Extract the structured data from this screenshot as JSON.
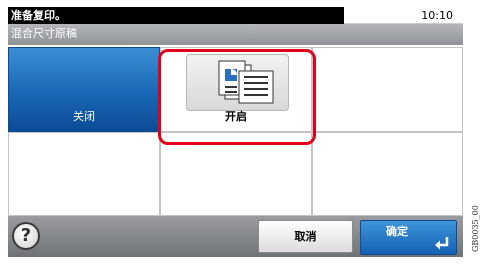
{
  "status": {
    "message": "准备复印。",
    "time": "10:10"
  },
  "title": "混合尺寸原稿",
  "options": [
    {
      "label": "关闭",
      "selected": true
    },
    {
      "label": "开启",
      "selected": false
    }
  ],
  "icons": {
    "help": "help-icon",
    "enter": "enter-icon",
    "option_on": "mixed-size-originals-icon"
  },
  "help_glyph": "?",
  "buttons": {
    "cancel": "取消",
    "ok": "确定"
  },
  "colors": {
    "selected_blue": "#1a66b6",
    "highlight_red": "#e3001b"
  },
  "figure_code": "GB0035_00"
}
